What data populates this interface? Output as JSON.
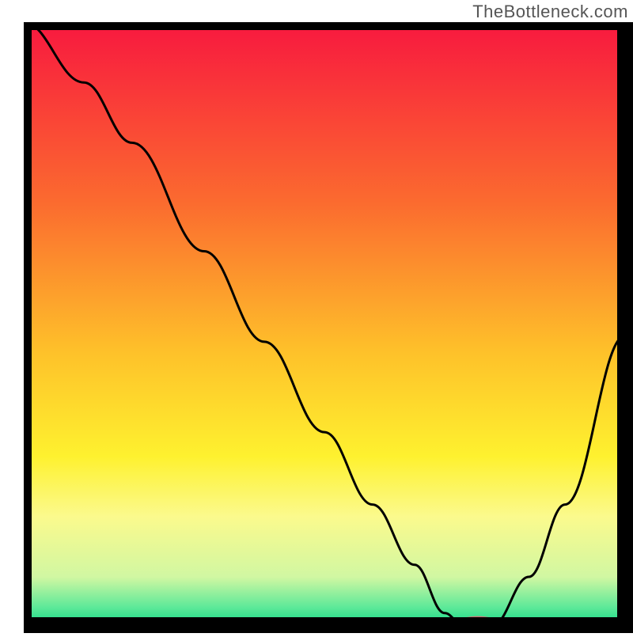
{
  "watermark": "TheBottleneck.com",
  "chart_data": {
    "type": "line",
    "title": "",
    "xlabel": "",
    "ylabel": "",
    "xlim": [
      0,
      100
    ],
    "ylim": [
      0,
      100
    ],
    "x": [
      0,
      10,
      18,
      30,
      40,
      50,
      58,
      65,
      70,
      73,
      78,
      84,
      90,
      100
    ],
    "values": [
      100,
      90,
      80,
      62,
      47,
      32,
      20,
      10,
      2,
      0,
      0,
      8,
      20,
      48
    ],
    "marker": {
      "x": 75.5,
      "y": 0.6,
      "rx": 3.0,
      "ry": 0.9,
      "color": "#cf6e73"
    },
    "gradient_stops": [
      {
        "pct": 0,
        "color": "#f8183f"
      },
      {
        "pct": 30,
        "color": "#fb6b2f"
      },
      {
        "pct": 55,
        "color": "#fec22a"
      },
      {
        "pct": 72,
        "color": "#fef12f"
      },
      {
        "pct": 82,
        "color": "#fbfa8d"
      },
      {
        "pct": 92,
        "color": "#d1f7a2"
      },
      {
        "pct": 97,
        "color": "#5ee999"
      },
      {
        "pct": 100,
        "color": "#18da87"
      }
    ],
    "border_color": "#000000",
    "line_color": "#000000"
  }
}
